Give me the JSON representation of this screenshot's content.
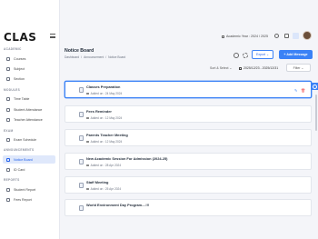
{
  "brand": {
    "logo": "CLAS"
  },
  "sidebar": {
    "sections": [
      {
        "label": "ACADEMIC",
        "items": [
          {
            "label": "Courses"
          },
          {
            "label": "Subject"
          },
          {
            "label": "Section"
          }
        ]
      },
      {
        "label": "MODULES",
        "items": [
          {
            "label": "Time Table"
          },
          {
            "label": "Student Attendance"
          },
          {
            "label": "Teacher Attendance"
          }
        ]
      },
      {
        "label": "EXAM",
        "items": [
          {
            "label": "Exam Schedule"
          }
        ]
      },
      {
        "label": "ANNOUNCEMENTS",
        "items": [
          {
            "label": "Notice Board",
            "active": true
          },
          {
            "label": "ID Card"
          }
        ]
      },
      {
        "label": "REPORTS",
        "items": [
          {
            "label": "Student Report"
          },
          {
            "label": "Fees Report"
          }
        ]
      }
    ]
  },
  "topbar": {
    "academic_year": "Academic Year : 2024 / 2025"
  },
  "header": {
    "title": "Notice Board",
    "breadcrumb": [
      "Dashboard",
      "/",
      "Announcement",
      "/",
      "Notice Board"
    ],
    "export_label": "Export ⌄",
    "add_label": "+ Add Message"
  },
  "filters": {
    "select_label": "Sort & Select ⌄",
    "date_range": "2025/12/23 - 2025/12/31",
    "filter_label": "Filter ⌄"
  },
  "notices": [
    {
      "title": "Classes Preparation",
      "added": "Added on : 24 May 2024",
      "selected": true
    },
    {
      "title": "Fees Reminder",
      "added": "Added on : 12 May 2024"
    },
    {
      "title": "Parents Teacher Meeting",
      "added": "Added on : 12 May 2024"
    },
    {
      "title": "New Academic Session For Admission (2024-25)",
      "added": "Added on : 28 Apr 2024"
    },
    {
      "title": "Staff Meeting",
      "added": "Added on : 25 Apr 2024"
    },
    {
      "title": "World Environment Day Program....!!!",
      "added": ""
    }
  ],
  "colors": {
    "accent": "#3b82f6",
    "danger": "#ef4444"
  }
}
